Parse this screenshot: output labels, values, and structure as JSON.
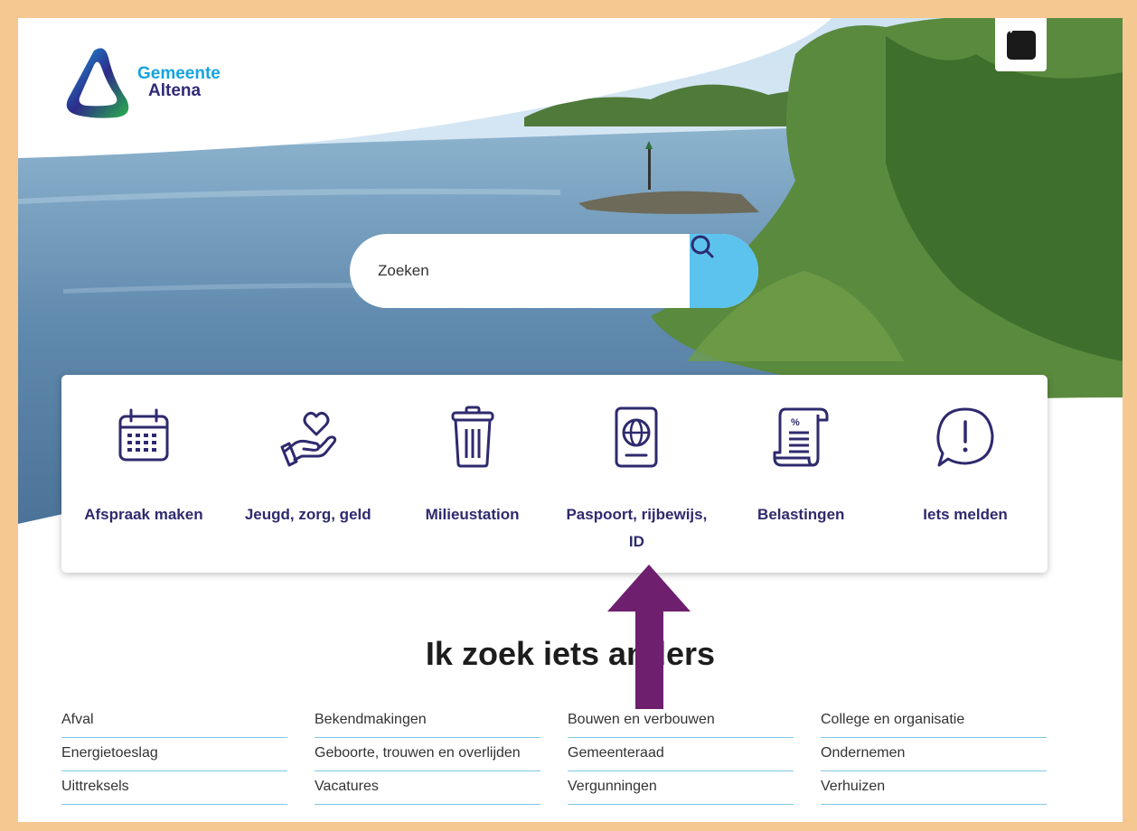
{
  "logo": {
    "line1": "Gemeente",
    "line2": "Altena"
  },
  "search": {
    "placeholder": "Zoeken"
  },
  "quick_links": [
    {
      "label": "Afspraak maken",
      "icon": "calendar-icon"
    },
    {
      "label": "Jeugd, zorg, geld",
      "icon": "heart-hand-icon"
    },
    {
      "label": "Milieustation",
      "icon": "trash-icon"
    },
    {
      "label": "Paspoort, rijbewijs, ID",
      "icon": "passport-icon"
    },
    {
      "label": "Belastingen",
      "icon": "tax-document-icon"
    },
    {
      "label": "Iets melden",
      "icon": "exclamation-bubble-icon"
    }
  ],
  "other": {
    "title": "Ik zoek iets anders",
    "links": [
      "Afval",
      "Bekendmakingen",
      "Bouwen en verbouwen",
      "College en organisatie",
      "Energietoeslag",
      "Geboorte, trouwen en overlijden",
      "Gemeenteraad",
      "Ondernemen",
      "Uittreksels",
      "Vacatures",
      "Vergunningen",
      "Verhuizen"
    ]
  },
  "colors": {
    "brand_dark": "#2e2a6e",
    "search_button": "#5cc3ee",
    "frame": "#f5c891",
    "arrow": "#6e1f6e"
  }
}
